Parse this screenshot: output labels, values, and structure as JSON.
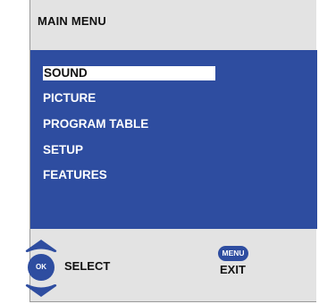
{
  "title": "MAIN MENU",
  "menu": {
    "items": [
      {
        "label": "SOUND",
        "selected": true
      },
      {
        "label": "PICTURE",
        "selected": false
      },
      {
        "label": "PROGRAM TABLE",
        "selected": false
      },
      {
        "label": "SETUP",
        "selected": false
      },
      {
        "label": "FEATURES",
        "selected": false
      }
    ]
  },
  "footer": {
    "ok_label": "OK",
    "select_label": "SELECT",
    "menu_button_label": "MENU",
    "exit_label": "EXIT"
  },
  "colors": {
    "panel": "#2e4da0",
    "background": "#e3e3e3",
    "highlight": "#ffffff"
  }
}
